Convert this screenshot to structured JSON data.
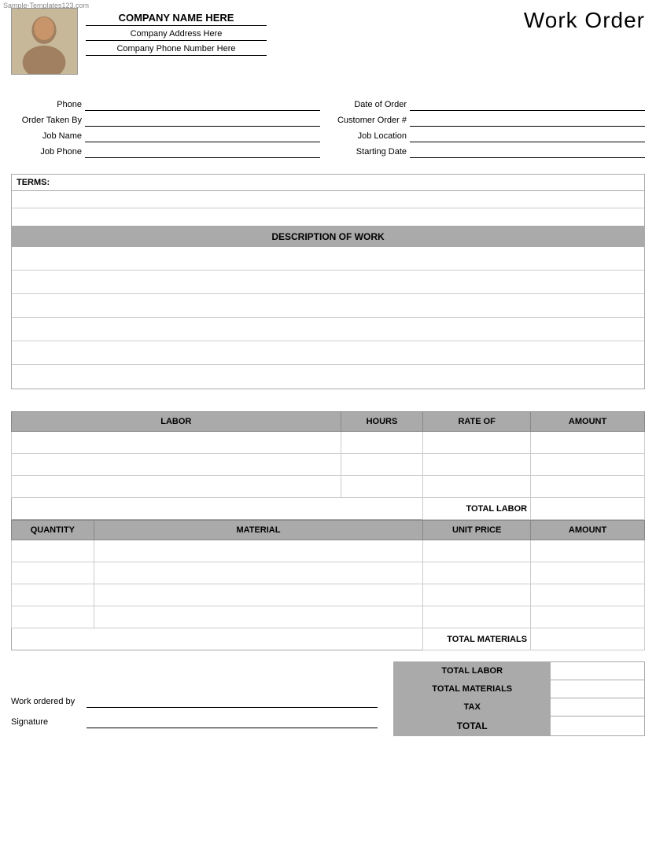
{
  "watermark": "Sample-Templates123.com",
  "header": {
    "company_name": "COMPANY NAME HERE",
    "company_address": "Company Address Here",
    "company_phone": "Company Phone Number Here",
    "title": "Work Order"
  },
  "form": {
    "left": [
      {
        "label": "Phone",
        "value": ""
      },
      {
        "label": "Order Taken By",
        "value": ""
      },
      {
        "label": "Job Name",
        "value": ""
      },
      {
        "label": "Job Phone",
        "value": ""
      }
    ],
    "right": [
      {
        "label": "Date of Order",
        "value": ""
      },
      {
        "label": "Customer Order #",
        "value": ""
      },
      {
        "label": "Job Location",
        "value": ""
      },
      {
        "label": "Starting Date",
        "value": ""
      }
    ]
  },
  "terms": {
    "header": "TERMS:",
    "rows": [
      "",
      ""
    ]
  },
  "description": {
    "header": "DESCRIPTION OF WORK",
    "rows": [
      "",
      "",
      "",
      "",
      "",
      ""
    ]
  },
  "labor_table": {
    "columns": [
      "LABOR",
      "HOURS",
      "RATE OF",
      "AMOUNT"
    ],
    "rows": [
      {
        "labor": "",
        "hours": "",
        "rate": "",
        "amount": ""
      },
      {
        "labor": "",
        "hours": "",
        "rate": "",
        "amount": ""
      },
      {
        "labor": "",
        "hours": "",
        "rate": "",
        "amount": ""
      }
    ],
    "total_label": "TOTAL LABOR"
  },
  "materials_table": {
    "columns": [
      "QUANTITY",
      "MATERIAL",
      "UNIT PRICE",
      "AMOUNT"
    ],
    "rows": [
      {
        "qty": "",
        "material": "",
        "unit_price": "",
        "amount": ""
      },
      {
        "qty": "",
        "material": "",
        "unit_price": "",
        "amount": ""
      },
      {
        "qty": "",
        "material": "",
        "unit_price": "",
        "amount": ""
      },
      {
        "qty": "",
        "material": "",
        "unit_price": "",
        "amount": ""
      }
    ],
    "total_label": "TOTAL MATERIALS"
  },
  "summary": {
    "rows": [
      {
        "label": "TOTAL LABOR",
        "value": ""
      },
      {
        "label": "TOTAL MATERIALS",
        "value": ""
      },
      {
        "label": "TAX",
        "value": ""
      },
      {
        "label": "TOTAL",
        "value": ""
      }
    ],
    "work_ordered_by_label": "Work ordered by",
    "signature_label": "Signature"
  }
}
